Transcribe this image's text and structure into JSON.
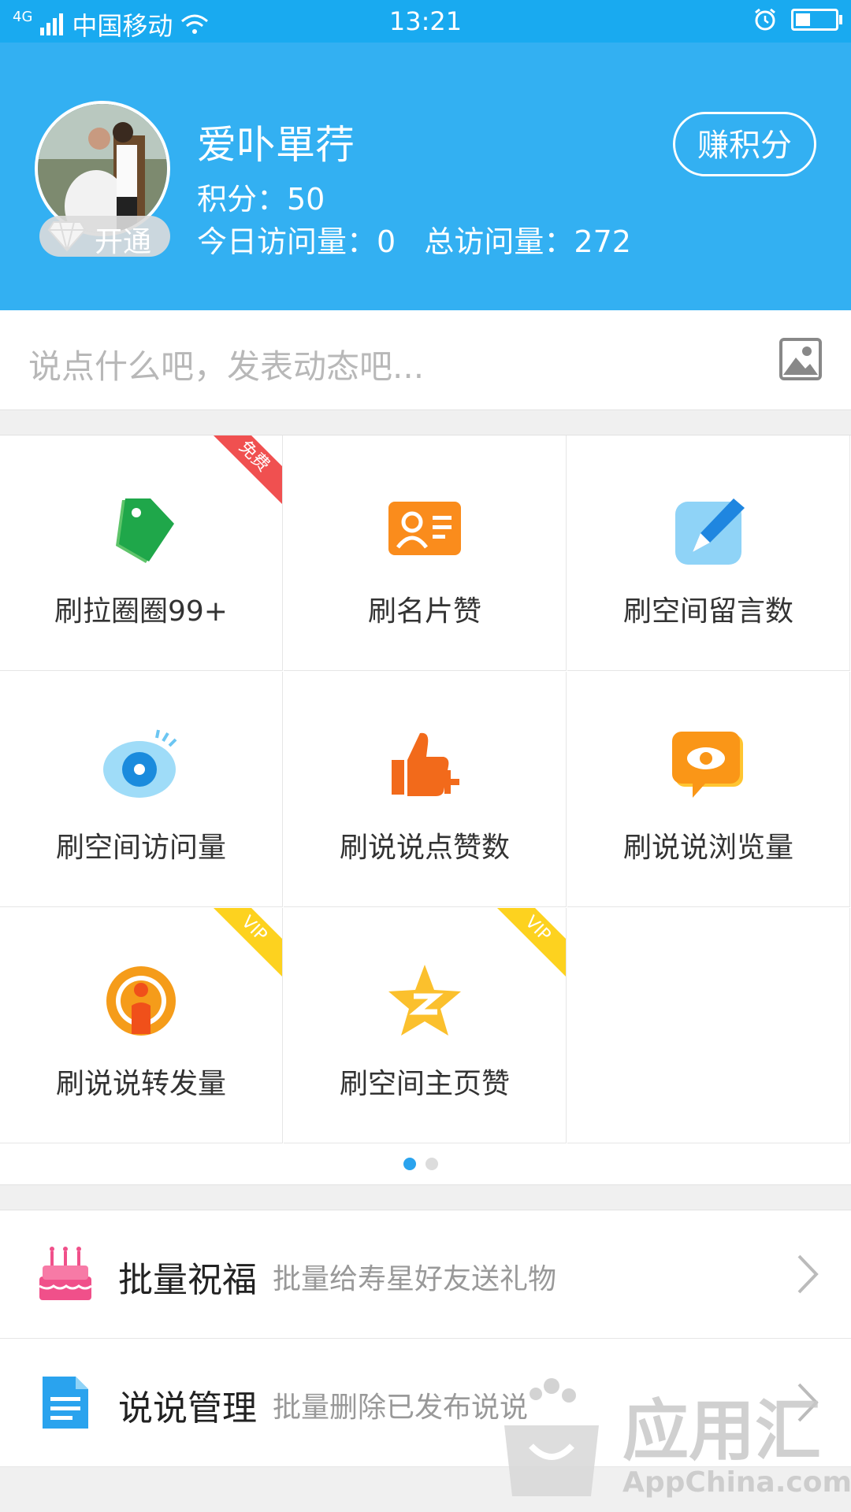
{
  "status_bar": {
    "network": "4G",
    "carrier": "中国移动",
    "time": "13:21",
    "icons": [
      "signal-icon",
      "wifi-icon",
      "alarm-icon",
      "battery-icon"
    ]
  },
  "profile": {
    "username": "爱卟單荇",
    "points_label": "积分：50",
    "visits_label": "今日访问量：0   总访问量：272",
    "vip_button": "开通",
    "earn_button": "赚积分"
  },
  "composer": {
    "placeholder": "说点什么吧，发表动态吧..."
  },
  "grid": {
    "items": [
      {
        "label": "刷拉圈圈99+",
        "icon": "tag-icon",
        "ribbon": "免费"
      },
      {
        "label": "刷名片赞",
        "icon": "id-card-icon",
        "ribbon": ""
      },
      {
        "label": "刷空间留言数",
        "icon": "pen-icon",
        "ribbon": ""
      },
      {
        "label": "刷空间访问量",
        "icon": "eye-icon",
        "ribbon": ""
      },
      {
        "label": "刷说说点赞数",
        "icon": "thumbs-up-plus-icon",
        "ribbon": ""
      },
      {
        "label": "刷说说浏览量",
        "icon": "eye-bubble-icon",
        "ribbon": ""
      },
      {
        "label": "刷说说转发量",
        "icon": "broadcast-person-icon",
        "ribbon": "VIP"
      },
      {
        "label": "刷空间主页赞",
        "icon": "qzone-star-icon",
        "ribbon": "VIP"
      }
    ],
    "page_indicator": {
      "pages": 2,
      "active": 1
    }
  },
  "list": [
    {
      "title": "批量祝福",
      "desc": "批量给寿星好友送礼物",
      "icon": "cake-icon"
    },
    {
      "title": "说说管理",
      "desc": "批量删除已发布说说",
      "icon": "document-icon"
    }
  ],
  "watermark": {
    "brand": "应用汇",
    "site": "AppChina.com"
  },
  "colors": {
    "primary": "#33b0f2",
    "status_bar": "#19aaf0",
    "free_ribbon": "#f05050",
    "vip_ribbon": "#fdd21f"
  }
}
